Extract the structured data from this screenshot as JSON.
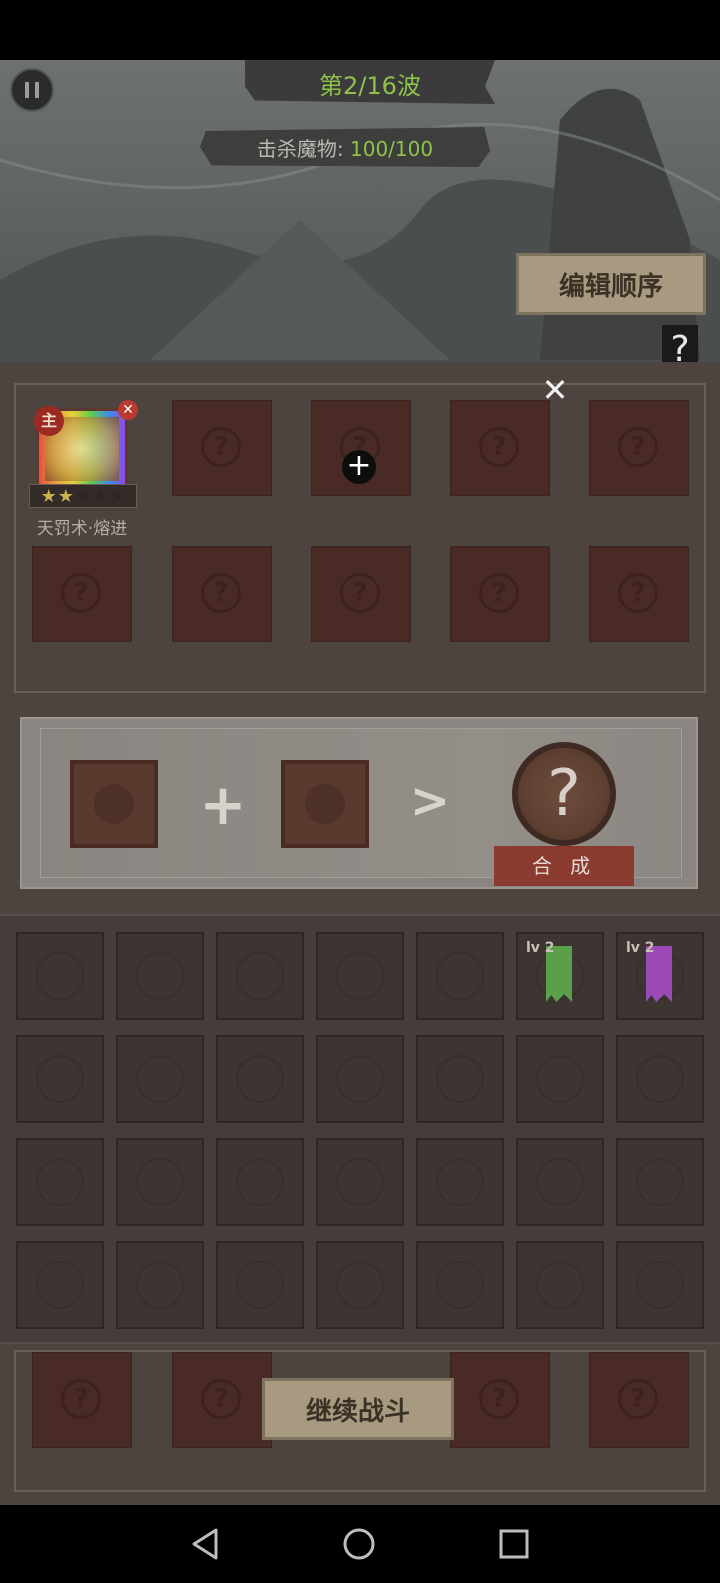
{
  "hud": {
    "wave_text": "第2/16波",
    "kill_label": "击杀魔物:",
    "kill_value": "100/100",
    "edit_order_label": "编辑顺序",
    "help_label": "?"
  },
  "skill_panel": {
    "equipped_skill": {
      "name": "天罚术·熔进",
      "badge": "主",
      "stars_filled": 2,
      "stars_total": 5
    },
    "empty_slot_glyph": "?",
    "add_marker": "+",
    "close_label": "✕"
  },
  "craft": {
    "plus": "+",
    "arrow": ">",
    "result_glyph": "?",
    "button_label": "合 成"
  },
  "inventory": {
    "items": [
      {
        "level": "lv 2",
        "color": "#5aa04a"
      },
      {
        "level": "lv 2",
        "color": "#9b4ab8"
      }
    ]
  },
  "continue_label": "继续战斗"
}
